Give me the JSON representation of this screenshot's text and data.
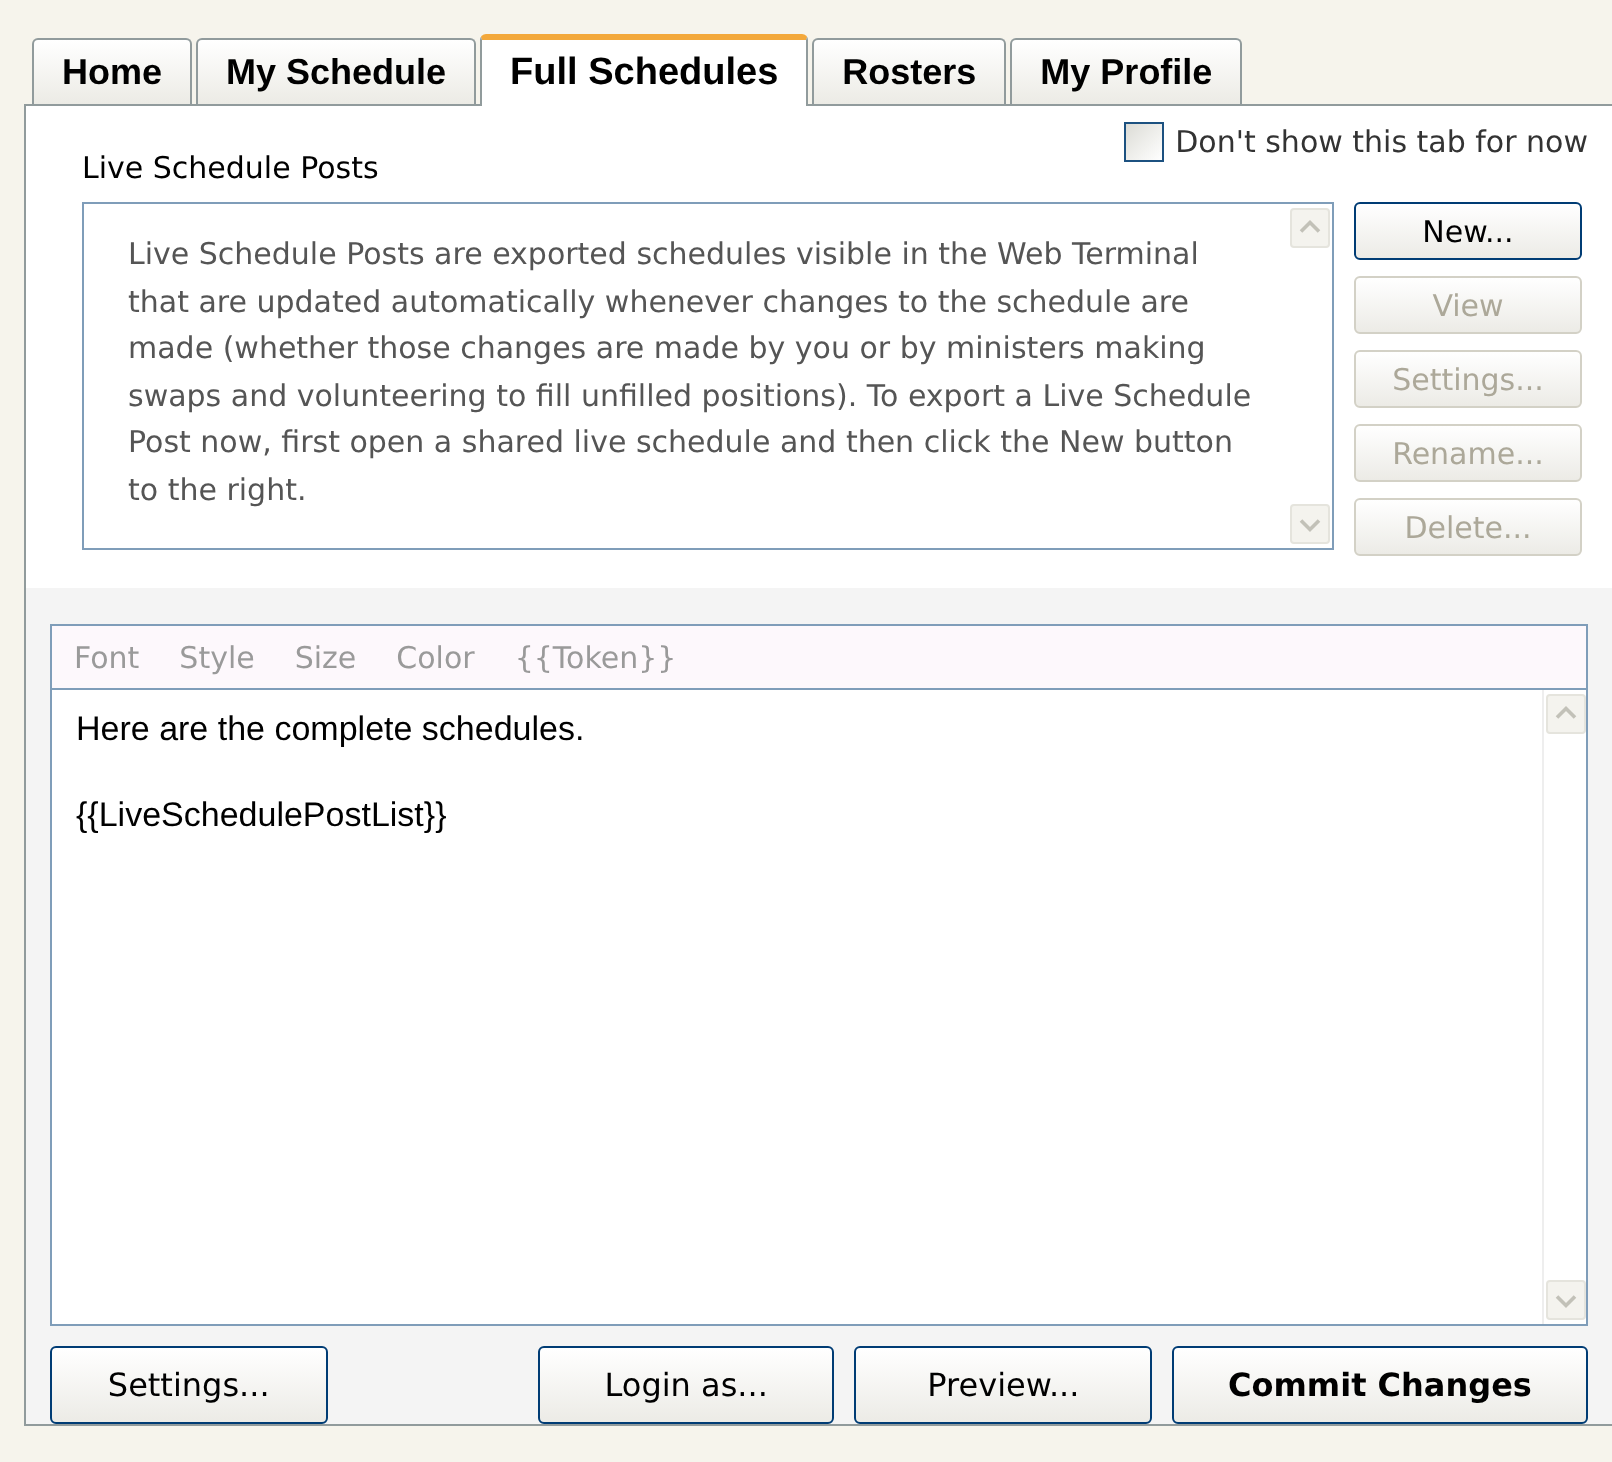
{
  "tabs": [
    {
      "label": "Home",
      "selected": false
    },
    {
      "label": "My Schedule",
      "selected": false
    },
    {
      "label": "Full Schedules",
      "selected": true
    },
    {
      "label": "Rosters",
      "selected": false
    },
    {
      "label": "My Profile",
      "selected": false
    }
  ],
  "hide_tab_checkbox": {
    "label": "Don't show this tab for now",
    "checked": false
  },
  "posts_section": {
    "title": "Live Schedule Posts",
    "description": "Live Schedule Posts are exported schedules visible in the Web Terminal that are updated automatically whenever changes to the schedule are made (whether those changes are made by you or by ministers making swaps and volunteering to fill unfilled positions). To export a Live Schedule Post now, first open a shared live schedule and then click the New button to the right.",
    "buttons": [
      {
        "label": "New...",
        "disabled": false
      },
      {
        "label": "View",
        "disabled": true
      },
      {
        "label": "Settings...",
        "disabled": true
      },
      {
        "label": "Rename...",
        "disabled": true
      },
      {
        "label": "Delete...",
        "disabled": true
      }
    ]
  },
  "editor": {
    "toolbar": [
      "Font",
      "Style",
      "Size",
      "Color",
      "{{Token}}"
    ],
    "lines": [
      "Here are the complete schedules.",
      "{{LiveSchedulePostList}}"
    ]
  },
  "bottom_buttons": [
    {
      "label": "Settings...",
      "emphasized": false
    },
    {
      "label": "Login as...",
      "emphasized": false
    },
    {
      "label": "Preview...",
      "emphasized": false
    },
    {
      "label": "Commit Changes",
      "emphasized": true
    }
  ]
}
